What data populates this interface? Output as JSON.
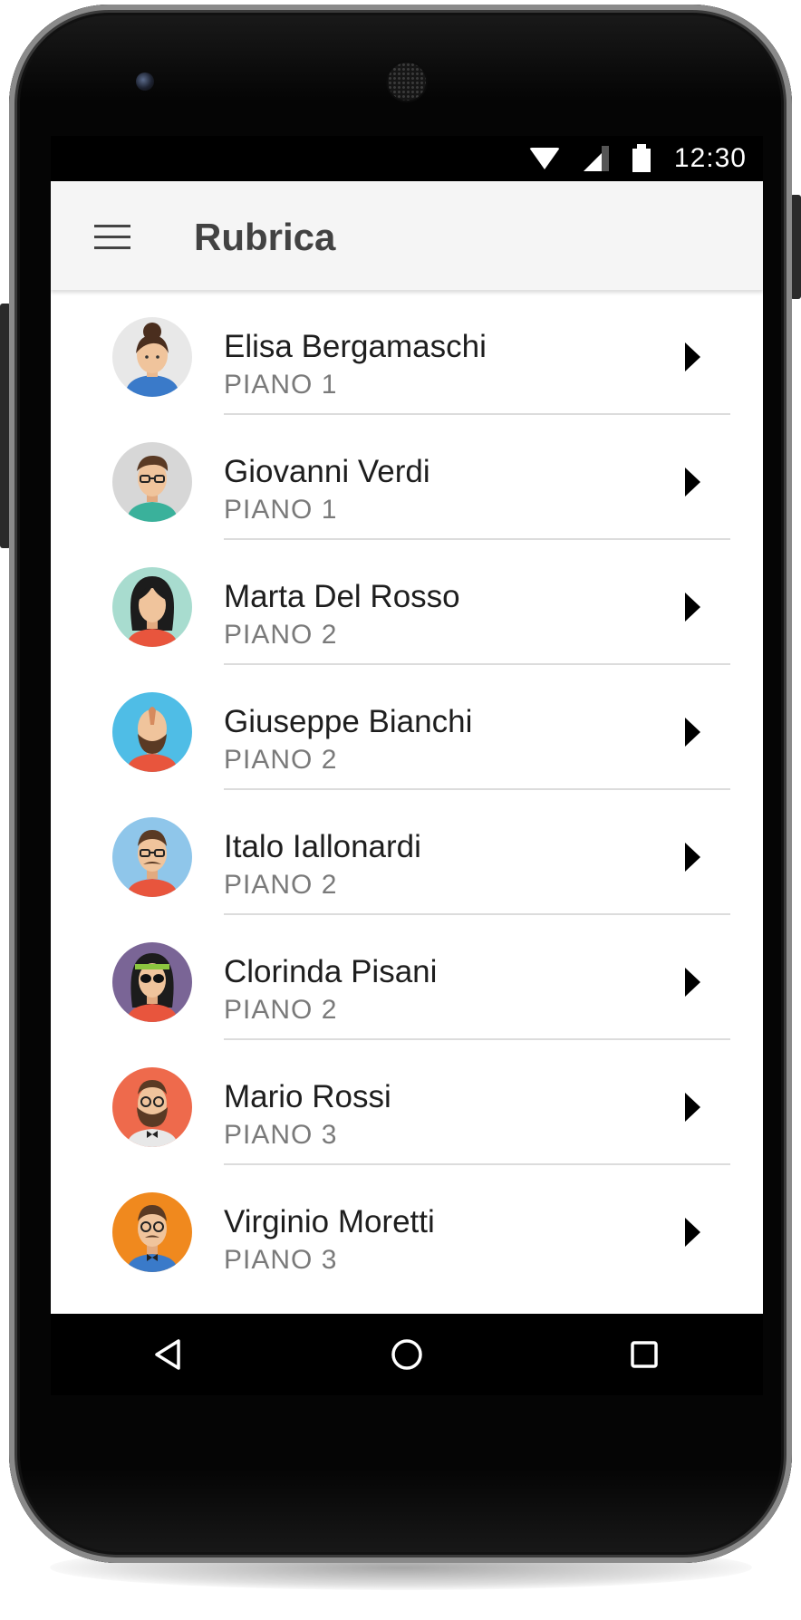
{
  "status_bar": {
    "time": "12:30",
    "icons": [
      "wifi-icon",
      "signal-icon",
      "battery-icon"
    ]
  },
  "app_bar": {
    "menu_icon": "hamburger-menu-icon",
    "title": "Rubrica"
  },
  "contacts": [
    {
      "name": "Elisa Bergamaschi",
      "floor": "PIANO 1",
      "avatar_color": "#e8e8e8"
    },
    {
      "name": "Giovanni Verdi",
      "floor": "PIANO 1",
      "avatar_color": "#d7d7d7"
    },
    {
      "name": "Marta Del Rosso",
      "floor": "PIANO 2",
      "avatar_color": "#a8dccf"
    },
    {
      "name": "Giuseppe Bianchi",
      "floor": "PIANO 2",
      "avatar_color": "#4fbde6"
    },
    {
      "name": "Italo Iallonardi",
      "floor": "PIANO 2",
      "avatar_color": "#8fc6ea"
    },
    {
      "name": "Clorinda Pisani",
      "floor": "PIANO 2",
      "avatar_color": "#7a6596"
    },
    {
      "name": "Mario Rossi",
      "floor": "PIANO 3",
      "avatar_color": "#ee6a4c"
    },
    {
      "name": "Virginio Moretti",
      "floor": "PIANO 3",
      "avatar_color": "#f0891e"
    }
  ],
  "nav_bar": {
    "buttons": [
      "back-icon",
      "home-icon",
      "recents-icon"
    ]
  },
  "colors": {
    "app_bar": "#f5f5f5",
    "title_text": "#424242",
    "subtitle_text": "#7a7a7a",
    "divider": "#dcdcdc"
  }
}
